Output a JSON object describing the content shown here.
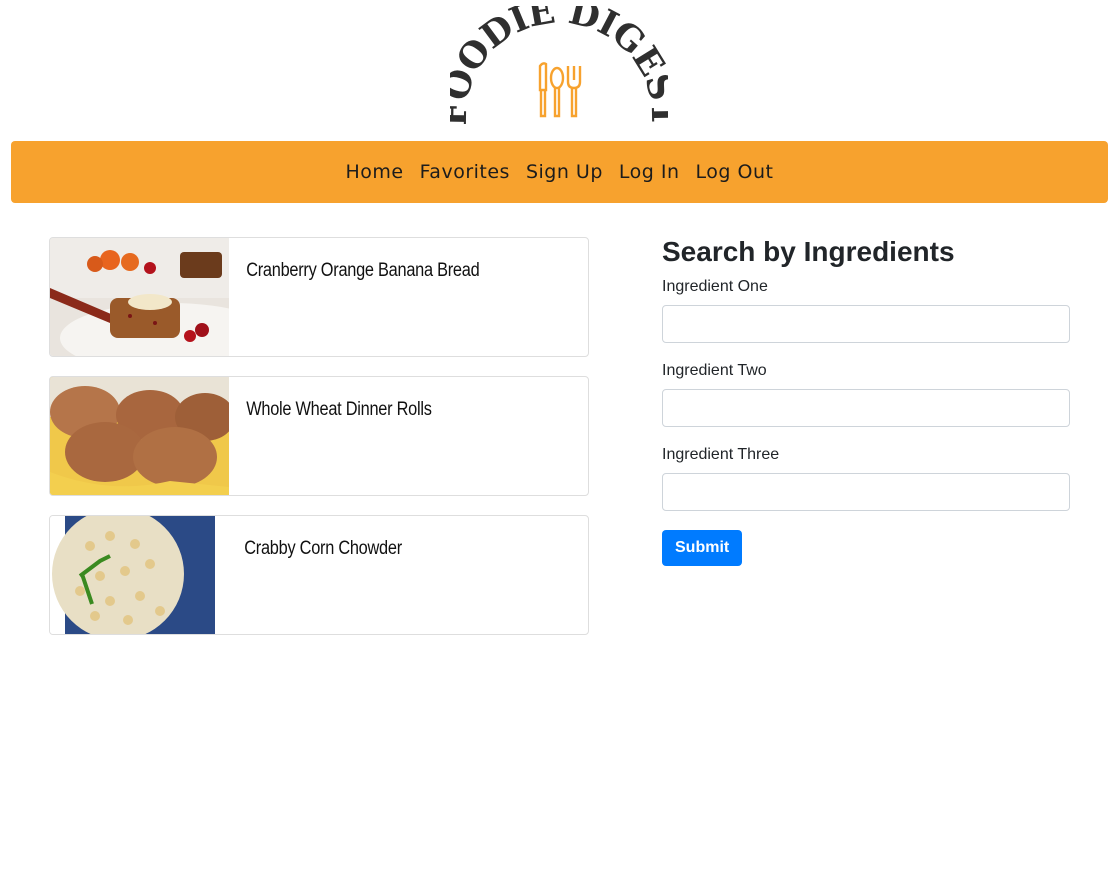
{
  "brand": {
    "logo_text": "FOODIE DIGEST",
    "accent_color": "#f7a22e",
    "logo_color": "#2f2f2f"
  },
  "nav": {
    "items": [
      {
        "label": "Home"
      },
      {
        "label": "Favorites"
      },
      {
        "label": "Sign Up"
      },
      {
        "label": "Log In"
      },
      {
        "label": "Log Out"
      }
    ]
  },
  "recipes": [
    {
      "title": "Cranberry Orange Banana Bread",
      "image": "cranberry-orange-banana-bread-photo"
    },
    {
      "title": "Whole Wheat Dinner Rolls",
      "image": "whole-wheat-dinner-rolls-photo"
    },
    {
      "title": "Crabby Corn Chowder",
      "image": "crabby-corn-chowder-photo"
    }
  ],
  "search": {
    "heading": "Search by Ingredients",
    "fields": [
      {
        "label": "Ingredient One",
        "value": "",
        "placeholder": ""
      },
      {
        "label": "Ingredient Two",
        "value": "",
        "placeholder": ""
      },
      {
        "label": "Ingredient Three",
        "value": "",
        "placeholder": ""
      }
    ],
    "submit_label": "Submit",
    "submit_color": "#007bff"
  }
}
